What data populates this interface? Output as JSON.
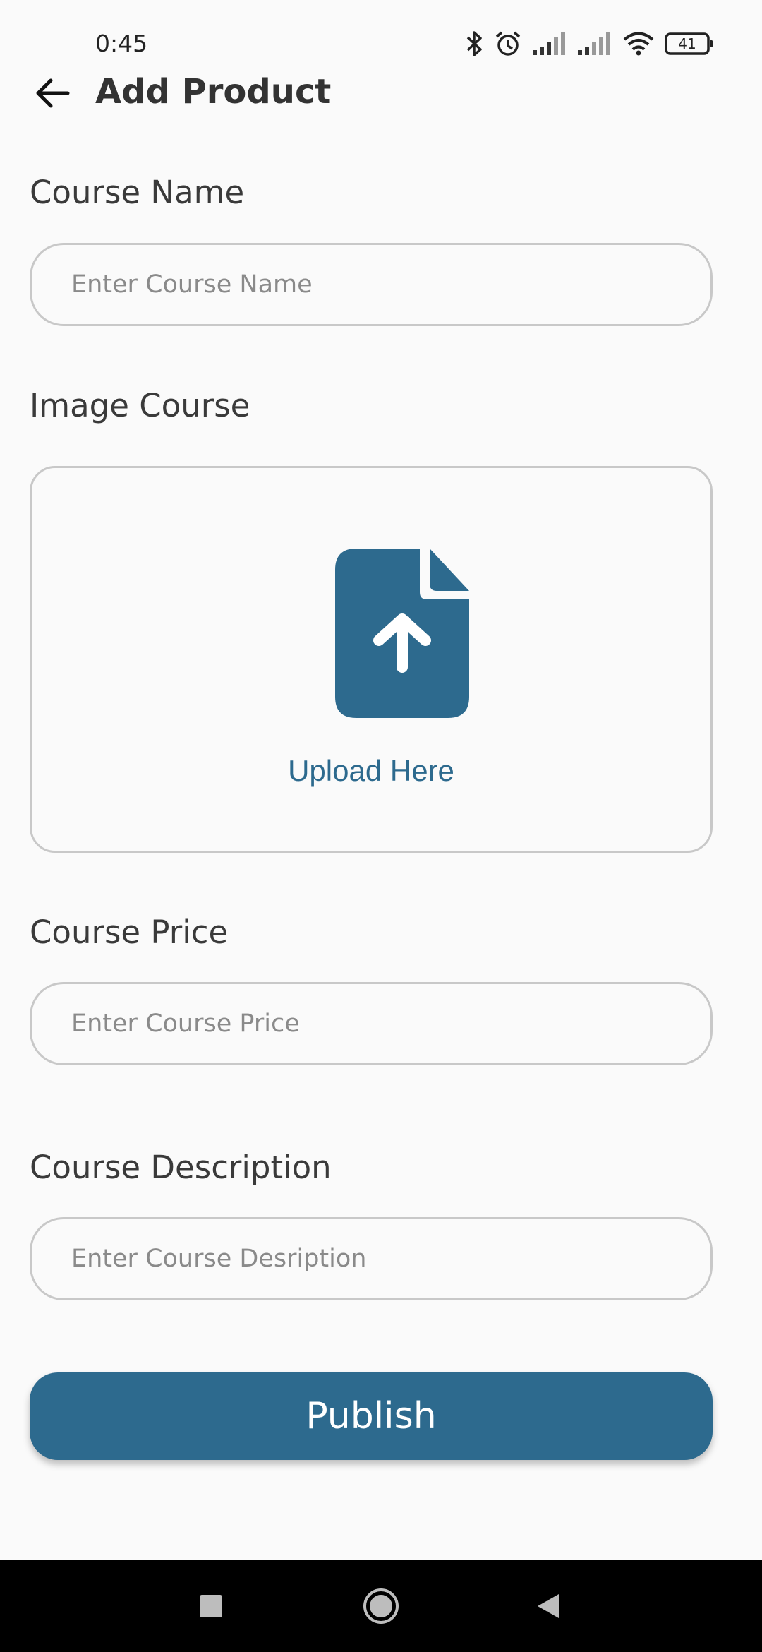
{
  "status_bar": {
    "time": "0:45",
    "battery": "41",
    "icons": [
      "bluetooth-icon",
      "alarm-icon",
      "signal-icon",
      "signal-icon",
      "wifi-icon",
      "battery-icon"
    ]
  },
  "app_bar": {
    "back_icon": "arrow-left-icon",
    "title": "Add Product"
  },
  "form": {
    "course_name": {
      "label": "Course Name",
      "value": "",
      "placeholder": "Enter Course Name"
    },
    "image_course": {
      "label": "Image Course",
      "upload_icon": "file-upload-icon",
      "upload_label": "Upload Here"
    },
    "course_price": {
      "label": "Course Price",
      "value": "",
      "placeholder": "Enter Course Price"
    },
    "course_description": {
      "label": "Course Description",
      "value": "",
      "placeholder": "Enter Course Desription"
    },
    "publish_label": "Publish"
  },
  "nav_bar": {
    "items": [
      "recents-square-icon",
      "home-circle-icon",
      "back-triangle-icon"
    ]
  },
  "colors": {
    "accent": "#2d6a8e",
    "background": "#fafafa",
    "border": "#c8c8c8",
    "nav_background": "#000000"
  }
}
